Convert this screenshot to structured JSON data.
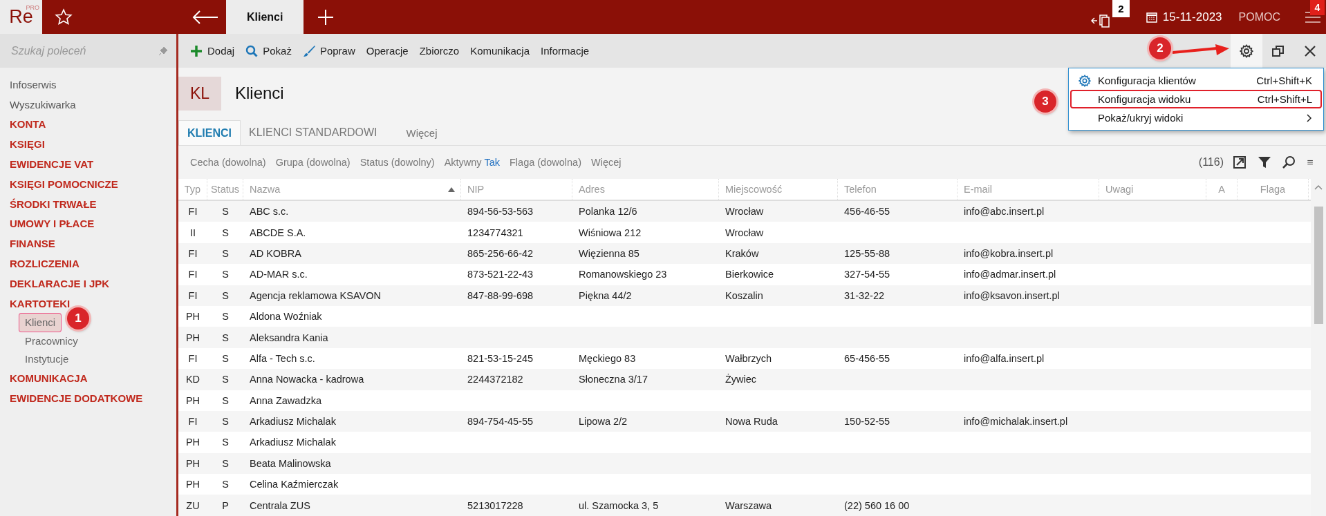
{
  "topbar": {
    "logo": "Re",
    "logo_sup": "PRO",
    "tabs": [
      {
        "label": "Klienci",
        "selected": true
      }
    ],
    "windows_badge": "2",
    "date": "15-11-2023",
    "help": "POMOC",
    "menu_badge": "4"
  },
  "sidebar": {
    "search": {
      "placeholder": "Szukaj poleceń"
    },
    "items": [
      {
        "label": "Infoserwis",
        "kind": "link"
      },
      {
        "label": "Wyszukiwarka",
        "kind": "link"
      },
      {
        "label": "KONTA",
        "kind": "category"
      },
      {
        "label": "KSIĘGI",
        "kind": "category"
      },
      {
        "label": "EWIDENCJE VAT",
        "kind": "category"
      },
      {
        "label": "KSIĘGI POMOCNICZE",
        "kind": "category"
      },
      {
        "label": "ŚRODKI TRWAŁE",
        "kind": "category"
      },
      {
        "label": "UMOWY I PŁACE",
        "kind": "category"
      },
      {
        "label": "FINANSE",
        "kind": "category"
      },
      {
        "label": "ROZLICZENIA",
        "kind": "category"
      },
      {
        "label": "DEKLARACJE I JPK",
        "kind": "category"
      },
      {
        "label": "KARTOTEKI",
        "kind": "category",
        "children": [
          {
            "label": "Klienci",
            "selected": true
          },
          {
            "label": "Pracownicy",
            "selected": false
          },
          {
            "label": "Instytucje",
            "selected": false
          }
        ]
      },
      {
        "label": "KOMUNIKACJA",
        "kind": "category"
      },
      {
        "label": "EWIDENCJE DODATKOWE",
        "kind": "category"
      }
    ]
  },
  "toolbar": {
    "buttons": [
      {
        "label": "Dodaj",
        "kind": "add"
      },
      {
        "label": "Pokaż",
        "kind": "search"
      },
      {
        "label": "Popraw",
        "kind": "edit"
      },
      {
        "label": "Operacje",
        "kind": "text"
      },
      {
        "label": "Zbiorczo",
        "kind": "text"
      },
      {
        "label": "Komunikacja",
        "kind": "text"
      },
      {
        "label": "Informacje",
        "kind": "text"
      }
    ]
  },
  "header": {
    "badge": "KL",
    "title": "Klienci"
  },
  "tabs": [
    {
      "label": "KLIENCI",
      "selected": true
    },
    {
      "label": "KLIENCI STANDARDOWI",
      "selected": false
    },
    {
      "label": "Więcej",
      "selected": false
    }
  ],
  "filters": [
    {
      "label": "Cecha (dowolna)"
    },
    {
      "label": "Grupa (dowolna)"
    },
    {
      "label": "Status (dowolny)"
    },
    {
      "label": "Aktywny",
      "value": "Tak"
    },
    {
      "label": "Flaga (dowolna)"
    },
    {
      "label": "Więcej"
    }
  ],
  "count": "(116)",
  "table": {
    "columns": [
      {
        "label": "Typ",
        "sorted": false
      },
      {
        "label": "Status",
        "sorted": false
      },
      {
        "label": "Nazwa",
        "sorted": true
      },
      {
        "label": "NIP",
        "sorted": false
      },
      {
        "label": "Adres",
        "sorted": false
      },
      {
        "label": "Miejscowość",
        "sorted": false
      },
      {
        "label": "Telefon",
        "sorted": false
      },
      {
        "label": "E-mail",
        "sorted": false
      },
      {
        "label": "Uwagi",
        "sorted": false
      },
      {
        "label": "A",
        "sorted": false
      },
      {
        "label": "Flaga",
        "sorted": false
      }
    ],
    "rows": [
      {
        "typ": "FI",
        "status": "S",
        "nazwa": "ABC s.c.",
        "nip": "894-56-53-563",
        "adres": "Polanka  12/6",
        "miasto": "Wrocław",
        "telefon": "456-46-55",
        "email": "info@abc.insert.pl"
      },
      {
        "typ": "II",
        "status": "S",
        "nazwa": "ABCDE S.A.",
        "nip": "1234774321",
        "adres": "Wiśniowa 212",
        "miasto": "Wrocław"
      },
      {
        "typ": "FI",
        "status": "S",
        "nazwa": "AD KOBRA",
        "nip": "865-256-66-42",
        "adres": "Więzienna  85",
        "miasto": "Kraków",
        "telefon": "125-55-88",
        "email": "info@kobra.insert.pl"
      },
      {
        "typ": "FI",
        "status": "S",
        "nazwa": "AD-MAR s.c.",
        "nip": "873-521-22-43",
        "adres": "Romanowskiego 23",
        "miasto": "Bierkowice",
        "telefon": "327-54-55",
        "email": "info@admar.insert.pl"
      },
      {
        "typ": "FI",
        "status": "S",
        "nazwa": "Agencja reklamowa KSAVON",
        "nip": "847-88-99-698",
        "adres": "Piękna  44/2",
        "miasto": "Koszalin",
        "telefon": "31-32-22",
        "email": "info@ksavon.insert.pl"
      },
      {
        "typ": "PH",
        "status": "S",
        "nazwa": "Aldona Woźniak"
      },
      {
        "typ": "PH",
        "status": "S",
        "nazwa": "Aleksandra Kania"
      },
      {
        "typ": "FI",
        "status": "S",
        "nazwa": "Alfa - Tech s.c.",
        "nip": "821-53-15-245",
        "adres": "Męckiego  83",
        "miasto": "Wałbrzych",
        "telefon": "65-456-55",
        "email": "info@alfa.insert.pl"
      },
      {
        "typ": "KD",
        "status": "S",
        "nazwa": "Anna Nowacka - kadrowa",
        "nip": "2244372182",
        "adres": "Słoneczna 3/17",
        "miasto": "Żywiec"
      },
      {
        "typ": "PH",
        "status": "S",
        "nazwa": "Anna Zawadzka"
      },
      {
        "typ": "FI",
        "status": "S",
        "nazwa": "Arkadiusz Michalak",
        "nip": "894-754-45-55",
        "adres": "Lipowa  2/2",
        "miasto": "Nowa Ruda",
        "telefon": "150-52-55",
        "email": "info@michalak.insert.pl"
      },
      {
        "typ": "PH",
        "status": "S",
        "nazwa": "Arkadiusz Michalak"
      },
      {
        "typ": "PH",
        "status": "S",
        "nazwa": "Beata Malinowska"
      },
      {
        "typ": "PH",
        "status": "S",
        "nazwa": "Celina Kaźmierczak"
      },
      {
        "typ": "ZU",
        "status": "P",
        "nazwa": "Centrala ZUS",
        "nip": "5213017228",
        "adres": "ul. Szamocka 3, 5",
        "miasto": "Warszawa",
        "telefon": "(22) 560 16 00"
      }
    ]
  },
  "menu": {
    "items": [
      {
        "label": "Konfiguracja klientów",
        "shortcut": "Ctrl+Shift+K",
        "kind": "gear",
        "highlighted": false
      },
      {
        "label": "Konfiguracja widoku",
        "shortcut": "Ctrl+Shift+L",
        "kind": "plain",
        "highlighted": true
      },
      {
        "label": "Pokaż/ukryj widoki",
        "kind": "submenu",
        "highlighted": false
      }
    ]
  },
  "annotations": [
    {
      "label": "1"
    },
    {
      "label": "2"
    },
    {
      "label": "3"
    }
  ]
}
